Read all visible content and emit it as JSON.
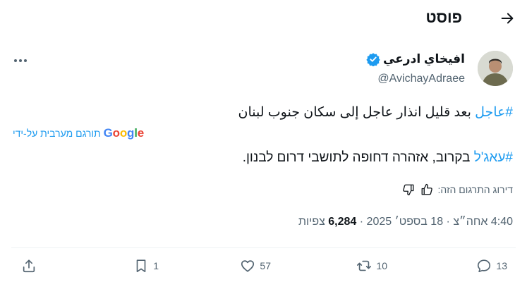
{
  "header": {
    "title": "פוסט",
    "back_icon": "arrow-right-icon"
  },
  "author": {
    "display_name": "افيخاي ادرعي",
    "handle": "@AvichayAdraee",
    "verified_icon": "verified-badge-icon",
    "verified_color": "#1d9bf0"
  },
  "tweet": {
    "line1_hashtag": "#عاجل",
    "line1_text": " بعد قليل انذار عاجل إلى سكان جنوب لبنان",
    "line2_hashtag": "#עאג'ל",
    "line2_text": " בקרוב, אזהרה דחופה לתושבי דרום לבנון."
  },
  "translation": {
    "label": "תורגם מערבית על-ידי",
    "provider": "Google"
  },
  "rating": {
    "label": "דירוג התרגום הזה:"
  },
  "meta": {
    "time": "4:40 אחה״צ",
    "date": "18 בספט׳ 2025",
    "views_count": "6,284",
    "views_label": "צפיות",
    "separator": "·"
  },
  "actions": {
    "replies": "13",
    "retweets": "10",
    "likes": "57",
    "bookmarks": "1"
  },
  "colors": {
    "accent": "#1d9bf0",
    "secondary_text": "#536471",
    "primary_text": "#0f1419"
  }
}
